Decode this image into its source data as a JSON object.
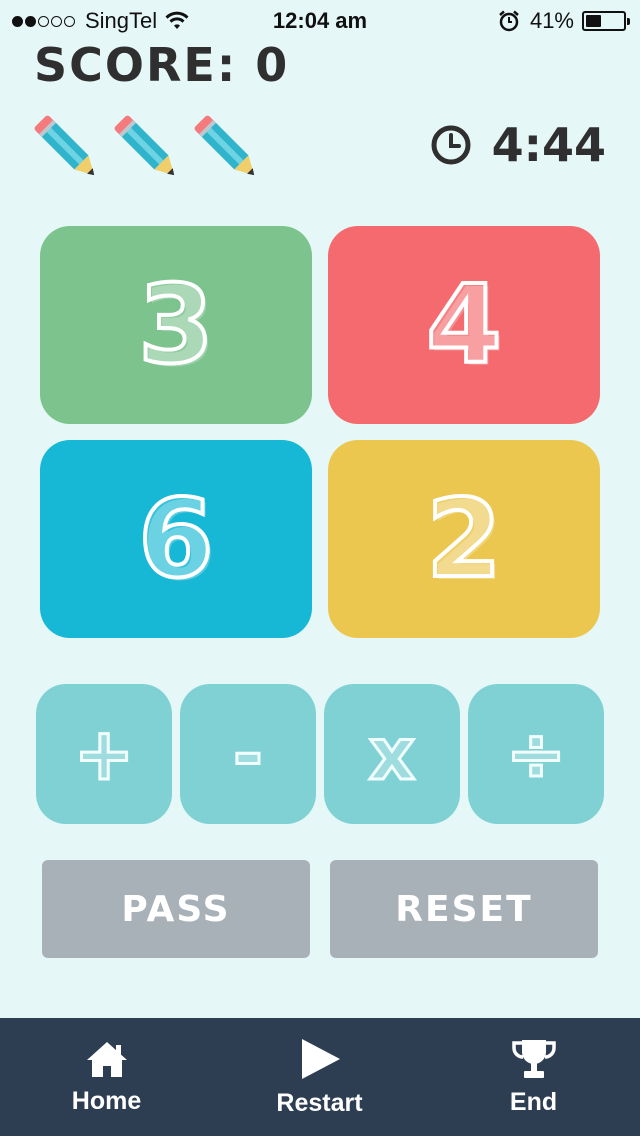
{
  "status_bar": {
    "signal_dots_filled": 2,
    "signal_dots_total": 5,
    "carrier": "SingTel",
    "time": "12:04 am",
    "battery_percent_label": "41%",
    "battery_level": 0.41
  },
  "game": {
    "score_label": "SCORE: 0",
    "lives_count": 3,
    "life_icon": "pencil-icon",
    "timer": "4:44",
    "timer_icon": "clock-icon"
  },
  "tiles": [
    {
      "value": "3",
      "color": "#7cc38e"
    },
    {
      "value": "4",
      "color": "#f46a6e"
    },
    {
      "value": "6",
      "color": "#16b8d5"
    },
    {
      "value": "2",
      "color": "#ebc74f"
    }
  ],
  "operators": [
    "+",
    "-",
    "x",
    "÷"
  ],
  "actions": {
    "pass_label": "PASS",
    "reset_label": "RESET"
  },
  "nav": {
    "home_label": "Home",
    "home_icon": "home-icon",
    "restart_label": "Restart",
    "restart_icon": "play-icon",
    "end_label": "End",
    "end_icon": "trophy-icon"
  },
  "colors": {
    "background": "#e6f7f7",
    "operator": "#7fd1d4",
    "action_button": "#a8b0b8",
    "nav_bar": "#2e3e52"
  }
}
